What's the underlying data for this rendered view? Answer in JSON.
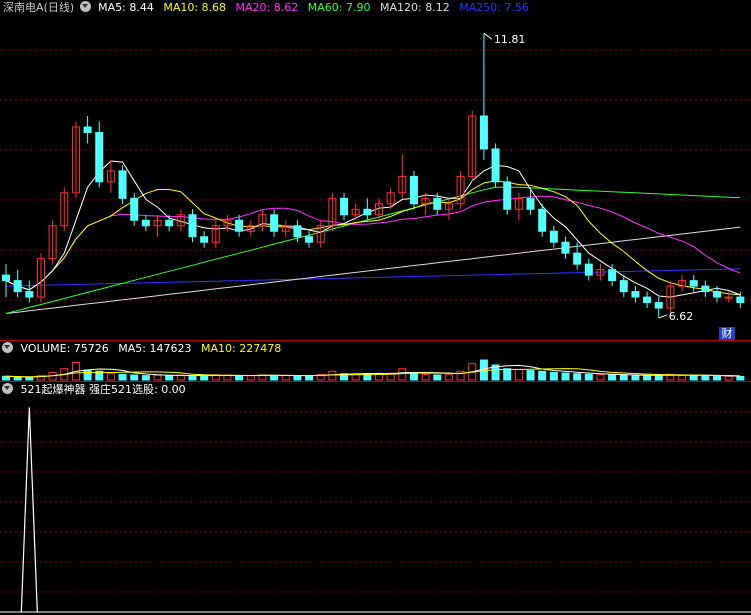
{
  "price_panel": {
    "title": "深南电A(日线)",
    "indicators": [
      {
        "label": "MA5: 8.44",
        "color": "#ffffff"
      },
      {
        "label": "MA10: 8.68",
        "color": "#ffff00"
      },
      {
        "label": "MA20: 8.62",
        "color": "#ff33ff"
      },
      {
        "label": "MA60: 7.90",
        "color": "#33ff33"
      },
      {
        "label": "MA120: 8.12",
        "color": "#dddddd"
      },
      {
        "label": "MA250: 7.56",
        "color": "#3333ff"
      }
    ],
    "high_label": "11.81",
    "low_label": "6.62",
    "badge": "财"
  },
  "volume_panel": {
    "indicators": [
      {
        "label": "VOLUME: 75726",
        "color": "#ffffff"
      },
      {
        "label": "MA5: 147623",
        "color": "#ffffff"
      },
      {
        "label": "MA10: 227478",
        "color": "#ffff00"
      }
    ]
  },
  "signal_panel": {
    "indicators": [
      {
        "label": "521起爆神器  强庄521选股: 0.00",
        "color": "#ffffff"
      }
    ]
  },
  "colors": {
    "up": "#ff3232",
    "down": "#54ffff",
    "grid": "#8a0000",
    "ma5": "#ffffff",
    "ma10": "#ffff00",
    "ma20": "#ff33ff",
    "ma60": "#33ff33",
    "ma120": "#dddddd",
    "ma250": "#3333ff"
  },
  "chart_data": {
    "type": "candlestick",
    "price_range": [
      6.4,
      12.05
    ],
    "candles": [
      [
        7.4,
        7.6,
        7.0,
        7.3
      ],
      [
        7.3,
        7.5,
        7.0,
        7.1
      ],
      [
        7.1,
        7.3,
        6.9,
        7.0
      ],
      [
        7.0,
        7.8,
        6.9,
        7.7
      ],
      [
        7.7,
        8.4,
        7.6,
        8.3
      ],
      [
        8.3,
        9.0,
        8.2,
        8.9
      ],
      [
        8.9,
        10.2,
        8.8,
        10.1
      ],
      [
        10.1,
        10.3,
        9.8,
        10.0
      ],
      [
        10.0,
        10.2,
        9.0,
        9.1
      ],
      [
        9.1,
        9.5,
        8.9,
        9.3
      ],
      [
        9.3,
        9.4,
        8.7,
        8.8
      ],
      [
        8.8,
        8.9,
        8.3,
        8.4
      ],
      [
        8.4,
        8.5,
        8.2,
        8.3
      ],
      [
        8.3,
        8.5,
        8.1,
        8.4
      ],
      [
        8.4,
        8.5,
        8.2,
        8.3
      ],
      [
        8.3,
        8.6,
        8.2,
        8.5
      ],
      [
        8.5,
        8.6,
        8.0,
        8.1
      ],
      [
        8.1,
        8.2,
        7.9,
        8.0
      ],
      [
        8.0,
        8.4,
        7.9,
        8.3
      ],
      [
        8.3,
        8.5,
        8.2,
        8.4
      ],
      [
        8.4,
        8.5,
        8.1,
        8.2
      ],
      [
        8.2,
        8.4,
        8.1,
        8.3
      ],
      [
        8.3,
        8.6,
        8.2,
        8.5
      ],
      [
        8.5,
        8.6,
        8.1,
        8.2
      ],
      [
        8.2,
        8.4,
        8.1,
        8.3
      ],
      [
        8.3,
        8.4,
        8.0,
        8.1
      ],
      [
        8.1,
        8.2,
        7.9,
        8.0
      ],
      [
        8.0,
        8.4,
        7.9,
        8.3
      ],
      [
        8.3,
        8.9,
        8.2,
        8.8
      ],
      [
        8.8,
        8.9,
        8.4,
        8.5
      ],
      [
        8.5,
        8.7,
        8.4,
        8.6
      ],
      [
        8.6,
        8.8,
        8.4,
        8.5
      ],
      [
        8.5,
        8.8,
        8.4,
        8.7
      ],
      [
        8.7,
        9.0,
        8.6,
        8.9
      ],
      [
        8.9,
        9.6,
        8.8,
        9.2
      ],
      [
        9.2,
        9.3,
        8.6,
        8.7
      ],
      [
        8.7,
        8.9,
        8.5,
        8.8
      ],
      [
        8.8,
        8.9,
        8.5,
        8.6
      ],
      [
        8.6,
        8.8,
        8.4,
        8.7
      ],
      [
        8.7,
        9.3,
        8.6,
        9.2
      ],
      [
        9.2,
        10.4,
        9.1,
        10.3
      ],
      [
        10.3,
        11.81,
        9.5,
        9.7
      ],
      [
        9.7,
        9.8,
        9.0,
        9.1
      ],
      [
        9.1,
        9.2,
        8.5,
        8.6
      ],
      [
        8.6,
        8.9,
        8.4,
        8.8
      ],
      [
        8.8,
        9.0,
        8.5,
        8.6
      ],
      [
        8.6,
        8.7,
        8.1,
        8.2
      ],
      [
        8.2,
        8.3,
        7.9,
        8.0
      ],
      [
        8.0,
        8.1,
        7.7,
        7.8
      ],
      [
        7.8,
        8.0,
        7.5,
        7.6
      ],
      [
        7.6,
        7.7,
        7.3,
        7.4
      ],
      [
        7.4,
        7.6,
        7.3,
        7.5
      ],
      [
        7.5,
        7.6,
        7.2,
        7.3
      ],
      [
        7.3,
        7.4,
        7.0,
        7.1
      ],
      [
        7.1,
        7.2,
        6.9,
        7.0
      ],
      [
        7.0,
        7.1,
        6.8,
        6.9
      ],
      [
        6.9,
        7.0,
        6.62,
        6.8
      ],
      [
        6.8,
        7.3,
        6.7,
        7.2
      ],
      [
        7.2,
        7.4,
        7.1,
        7.3
      ],
      [
        7.3,
        7.4,
        7.1,
        7.2
      ],
      [
        7.2,
        7.3,
        7.0,
        7.1
      ],
      [
        7.1,
        7.2,
        6.9,
        7.0
      ],
      [
        7.0,
        7.1,
        6.9,
        7.0
      ],
      [
        7.0,
        7.1,
        6.8,
        6.9
      ]
    ],
    "volumes": [
      30,
      25,
      20,
      35,
      60,
      90,
      140,
      80,
      70,
      50,
      45,
      40,
      35,
      38,
      33,
      40,
      36,
      30,
      42,
      38,
      35,
      34,
      40,
      38,
      36,
      32,
      30,
      45,
      70,
      50,
      48,
      45,
      50,
      55,
      90,
      60,
      45,
      40,
      42,
      70,
      130,
      160,
      120,
      90,
      85,
      75,
      70,
      60,
      55,
      50,
      45,
      42,
      40,
      38,
      35,
      34,
      40,
      45,
      38,
      35,
      32,
      30,
      30,
      28
    ],
    "signal_spike": {
      "index": 2,
      "height_ratio": 0.93
    }
  }
}
